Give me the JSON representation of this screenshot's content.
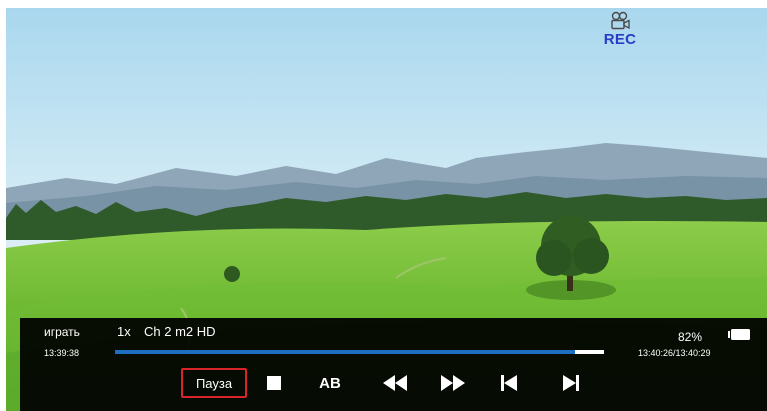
{
  "recording": {
    "label": "REC",
    "icon": "video-camera-icon",
    "color": "#2a3cc4"
  },
  "player": {
    "mode": "играть",
    "speed": "1x",
    "channel": "Ch 2 m2 HD",
    "current_time": "13:39:38",
    "total_time": "13:40:26/13:40:29",
    "volume": "82%",
    "progress": 0.94,
    "progress_color": "#1f6fc0"
  },
  "controls": {
    "pause_label": "Пауза",
    "stop_icon": "stop-icon",
    "ab_label": "AB",
    "rewind_icon": "rewind-icon",
    "fast_forward_icon": "fast-forward-icon",
    "previous_icon": "skip-previous-icon",
    "next_icon": "skip-next-icon",
    "focus_color": "#d9242a"
  }
}
